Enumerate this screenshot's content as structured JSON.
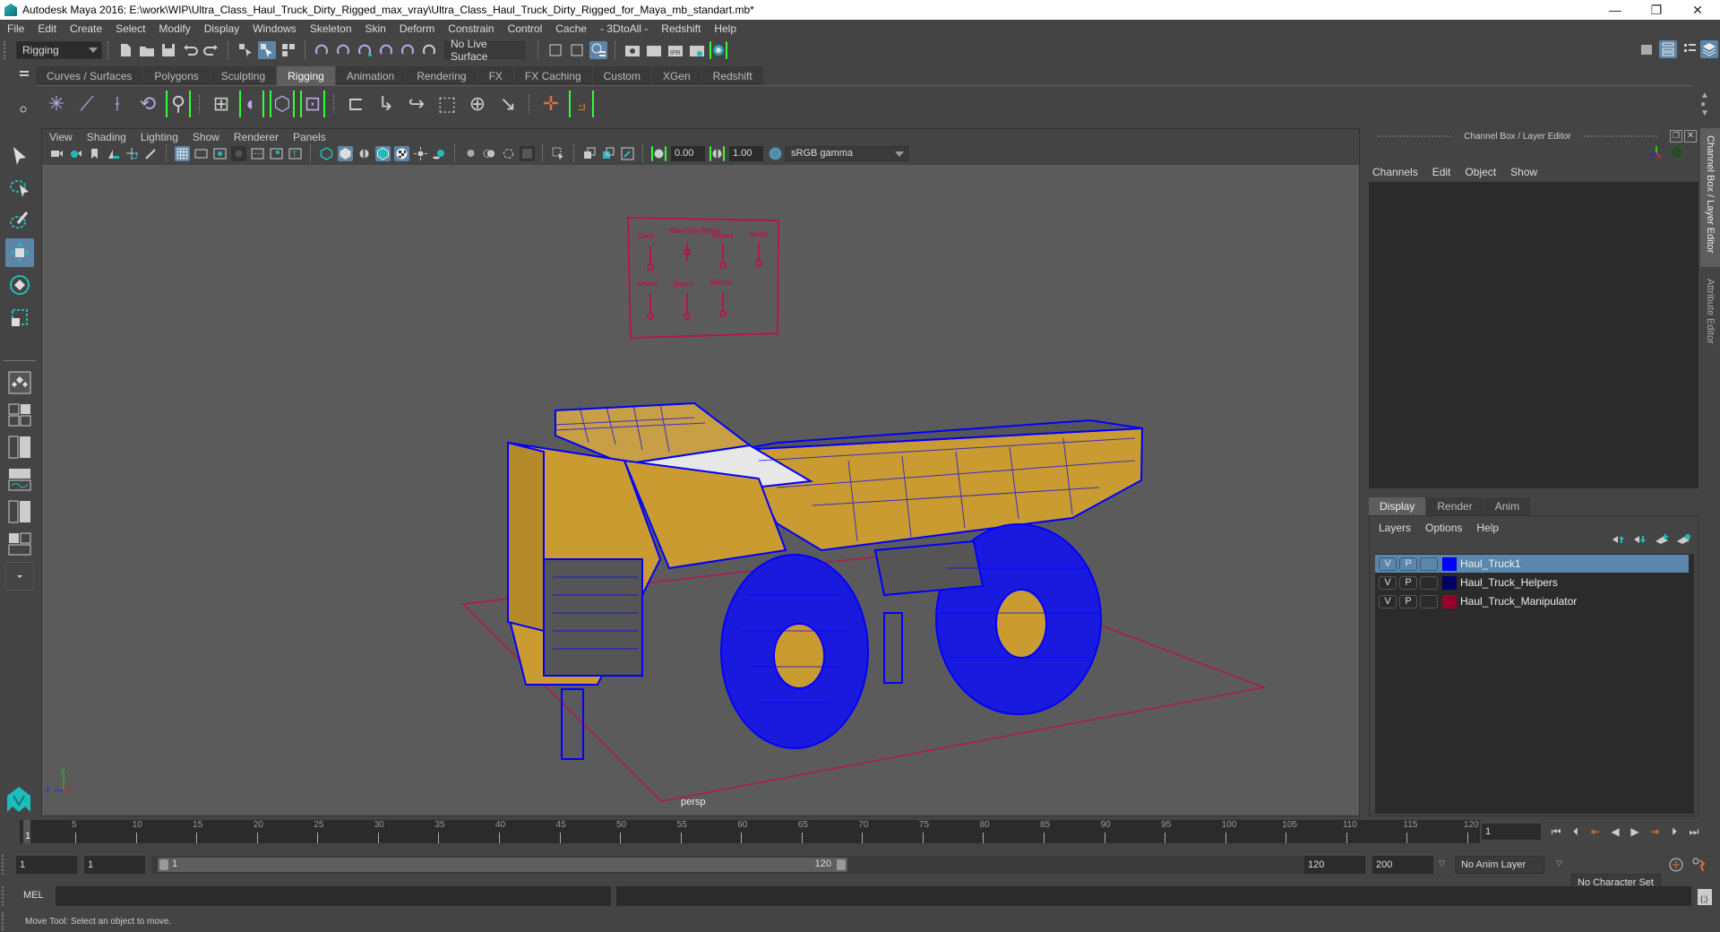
{
  "window": {
    "title": "Autodesk Maya 2016: E:\\work\\WIP\\Ultra_Class_Haul_Truck_Dirty_Rigged_max_vray\\Ultra_Class_Haul_Truck_Dirty_Rigged_for_Maya_mb_standart.mb*",
    "minimize": "—",
    "restore": "❐",
    "close": "✕"
  },
  "menubar": [
    "File",
    "Edit",
    "Create",
    "Select",
    "Modify",
    "Display",
    "Windows",
    "Skeleton",
    "Skin",
    "Deform",
    "Constrain",
    "Control",
    "Cache",
    "- 3DtoAll -",
    "Redshift",
    "Help"
  ],
  "statusline": {
    "menu_set": "Rigging",
    "live_surface": "No Live Surface"
  },
  "shelf_tabs": [
    "Curves / Surfaces",
    "Polygons",
    "Sculpting",
    "Rigging",
    "Animation",
    "Rendering",
    "FX",
    "FX Caching",
    "Custom",
    "XGen",
    "Redshift"
  ],
  "active_shelf_tab": "Rigging",
  "viewport": {
    "menus": [
      "View",
      "Shading",
      "Lighting",
      "Show",
      "Renderer",
      "Panels"
    ],
    "exposure": "0.00",
    "gamma": "1.00",
    "color_space": "sRGB gamma",
    "camera_label": "persp",
    "axis": {
      "x": "x",
      "y": "y",
      "z": "z"
    },
    "manipulator_labels": [
      "Door",
      "Steering Wheel",
      "Wheel",
      "Body",
      "Door2",
      "Stairs",
      "Gidraf"
    ]
  },
  "right_panel": {
    "title": "Channel Box / Layer Editor",
    "channel_menus": [
      "Channels",
      "Edit",
      "Object",
      "Show"
    ],
    "layer_tabs": [
      "Display",
      "Render",
      "Anim"
    ],
    "active_layer_tab": "Display",
    "layer_menus": [
      "Layers",
      "Options",
      "Help"
    ],
    "layers": [
      {
        "v": "V",
        "p": "P",
        "name": "Haul_Truck1",
        "color": "#0000ff",
        "selected": true
      },
      {
        "v": "V",
        "p": "P",
        "name": "Haul_Truck_Helpers",
        "color": "#000066",
        "selected": false
      },
      {
        "v": "V",
        "p": "P",
        "name": "Haul_Truck_Manipulator",
        "color": "#99002a",
        "selected": false
      }
    ],
    "side_tabs": [
      "Channel Box / Layer Editor",
      "Attribute Editor"
    ]
  },
  "timeline": {
    "ticks": [
      "5",
      "10",
      "15",
      "20",
      "25",
      "30",
      "35",
      "40",
      "45",
      "50",
      "55",
      "60",
      "65",
      "70",
      "75",
      "80",
      "85",
      "90",
      "95",
      "100",
      "105",
      "110",
      "115",
      "120"
    ],
    "start_marker": "1",
    "current_frame": "1"
  },
  "range": {
    "start": "1",
    "playback_start": "1",
    "slider_start": "1",
    "slider_end": "120",
    "playback_end": "120",
    "end": "200",
    "anim_layer": "No Anim Layer",
    "character_set": "No Character Set"
  },
  "cmdline": {
    "label": "MEL"
  },
  "helpline": "Move Tool: Select an object to move."
}
